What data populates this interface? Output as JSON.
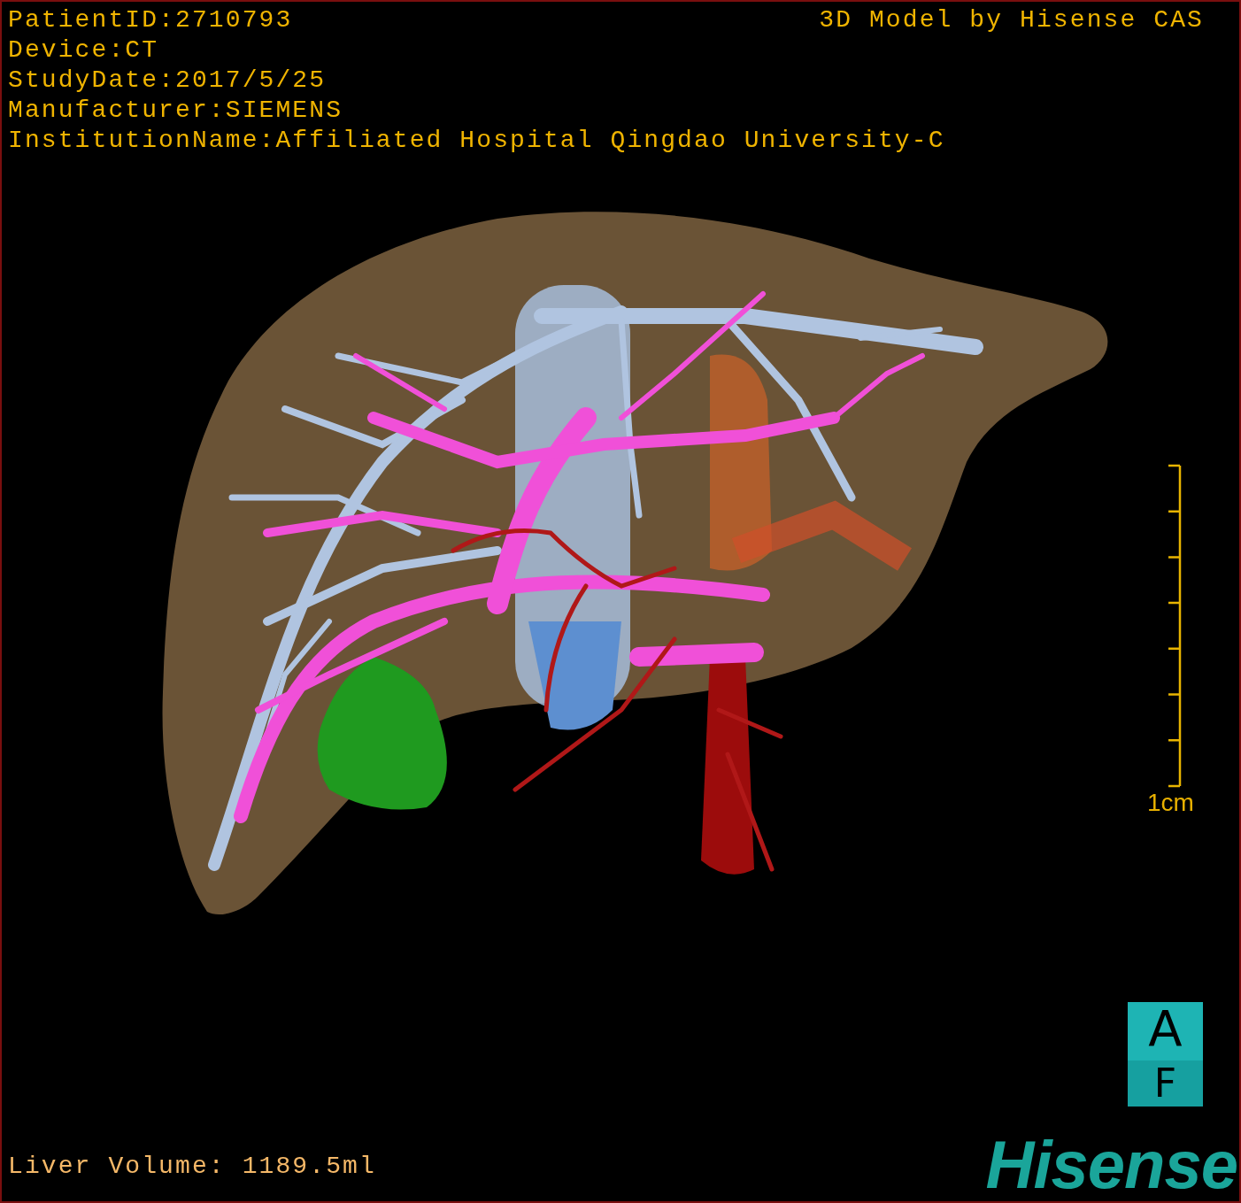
{
  "patient_info": [
    "PatientID:2710793",
    "Device:CT",
    "StudyDate:2017/5/25",
    "Manufacturer:SIEMENS",
    "InstitutionName:Affiliated Hospital Qingdao University-C"
  ],
  "model_credit": "3D Model by Hisense CAS",
  "scale_bar": {
    "label": "1cm"
  },
  "orientation_marker": {
    "top": "A",
    "bottom": "F"
  },
  "liver_volume": "Liver Volume: 1189.5ml",
  "logo": "Hisense"
}
